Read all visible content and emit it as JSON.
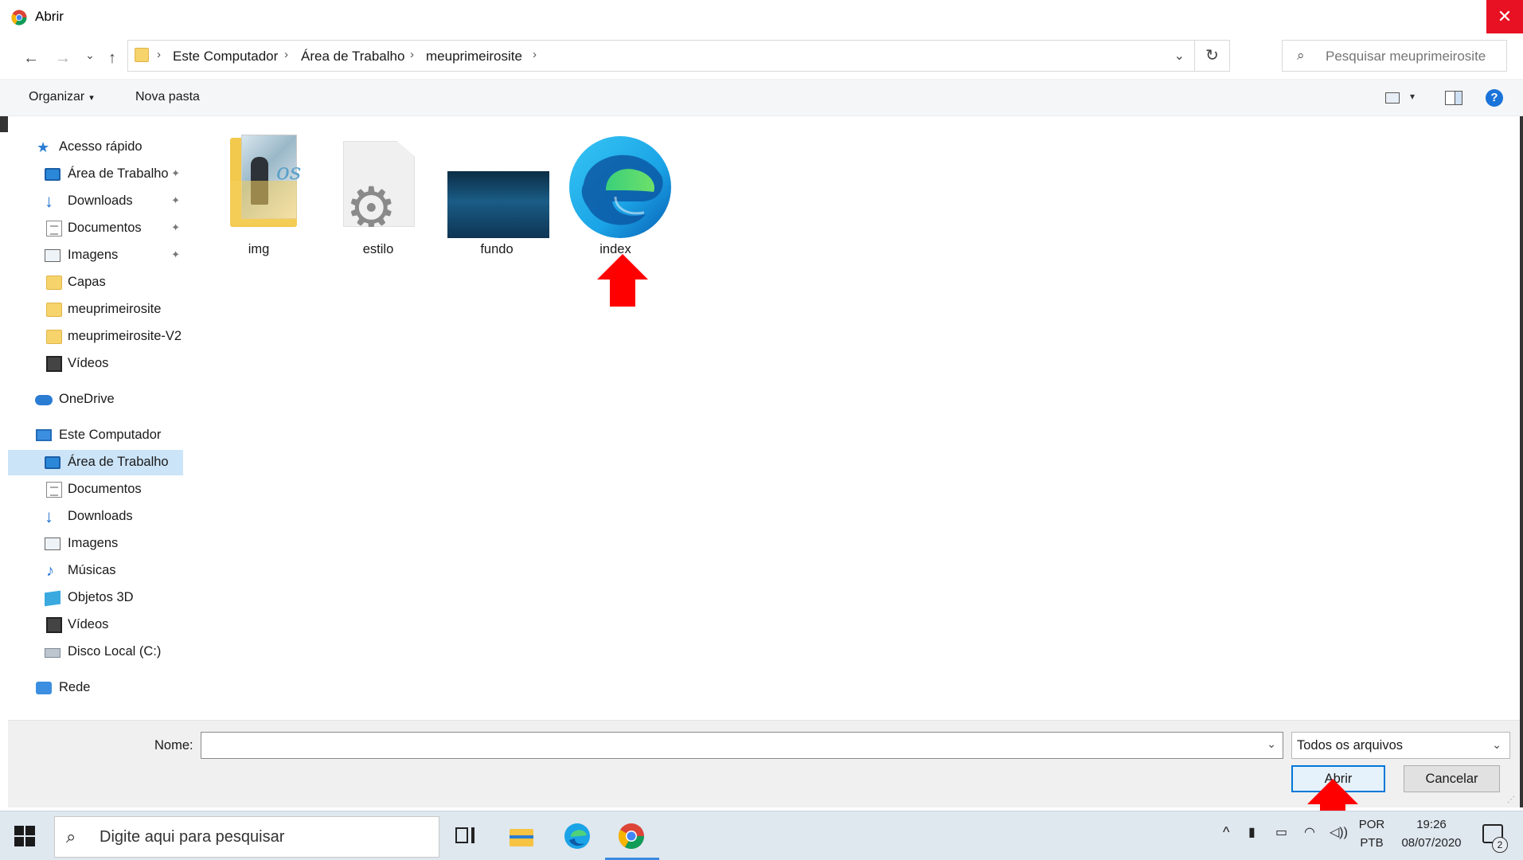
{
  "window": {
    "title": "Abrir",
    "close_glyph": "✕",
    "app_icon": "chrome-icon"
  },
  "navigation": {
    "back_glyph": "←",
    "forward_glyph": "→",
    "recent_glyph": "⌄",
    "up_glyph": "↑",
    "breadcrumb": [
      "Este Computador",
      "Área de Trabalho",
      "meuprimeirosite"
    ],
    "separator": "›",
    "dropdown_glyph": "⌄",
    "refresh_glyph": "↻",
    "search_placeholder": "Pesquisar meuprimeirosite",
    "search_icon": "search-icon"
  },
  "commandbar": {
    "organize_label": "Organizar",
    "organize_caret": "▾",
    "new_folder_label": "Nova pasta",
    "view_caret": "▾",
    "help_label": "?"
  },
  "sidebar": {
    "quick_access": "Acesso rápido",
    "quick_items": [
      {
        "label": "Área de Trabalho",
        "icon": "desktop-icon",
        "pinned": true
      },
      {
        "label": "Downloads",
        "icon": "download-icon",
        "pinned": true
      },
      {
        "label": "Documentos",
        "icon": "document-icon",
        "pinned": true
      },
      {
        "label": "Imagens",
        "icon": "pictures-icon",
        "pinned": true
      },
      {
        "label": "Capas",
        "icon": "folder-icon",
        "pinned": false
      },
      {
        "label": "meuprimeirosite",
        "icon": "folder-icon",
        "pinned": false
      },
      {
        "label": "meuprimeirosite-V2",
        "icon": "folder-icon",
        "pinned": false
      },
      {
        "label": "Vídeos",
        "icon": "videos-icon",
        "pinned": false
      }
    ],
    "onedrive": "OneDrive",
    "this_pc": "Este Computador",
    "pc_items": [
      {
        "label": "Área de Trabalho",
        "icon": "desktop-icon",
        "selected": true
      },
      {
        "label": "Documentos",
        "icon": "document-icon"
      },
      {
        "label": "Downloads",
        "icon": "download-icon"
      },
      {
        "label": "Imagens",
        "icon": "pictures-icon"
      },
      {
        "label": "Músicas",
        "icon": "music-icon"
      },
      {
        "label": "Objetos 3D",
        "icon": "3d-objects-icon"
      },
      {
        "label": "Vídeos",
        "icon": "videos-icon"
      },
      {
        "label": "Disco Local (C:)",
        "icon": "drive-icon"
      }
    ],
    "network": "Rede",
    "pin_glyph": "📌"
  },
  "files": [
    {
      "name": "img",
      "type": "folder"
    },
    {
      "name": "estilo",
      "type": "css-file"
    },
    {
      "name": "fundo",
      "type": "image-file"
    },
    {
      "name": "index",
      "type": "edge-html-file"
    }
  ],
  "bottom": {
    "name_label": "Nome:",
    "name_value": "",
    "filetype_value": "Todos os arquivos",
    "open_label": "Abrir",
    "cancel_label": "Cancelar",
    "dropdown_glyph": "⌄"
  },
  "taskbar": {
    "search_placeholder": "Digite aqui para pesquisar",
    "apps": [
      "task-view-icon",
      "file-explorer-icon",
      "edge-icon",
      "chrome-icon"
    ],
    "active_app": "chrome-icon",
    "language_line1": "POR",
    "language_line2": "PTB",
    "time": "19:26",
    "date": "08/07/2020",
    "notification_count": "2",
    "tray_chevron": "^",
    "tray_mic": "🎤",
    "tray_volume": "🕪"
  },
  "colors": {
    "close_red": "#e81123",
    "selection_blue": "#cce4f7",
    "primary_button_border": "#0078d7",
    "annotation_arrow": "#ff0000"
  }
}
